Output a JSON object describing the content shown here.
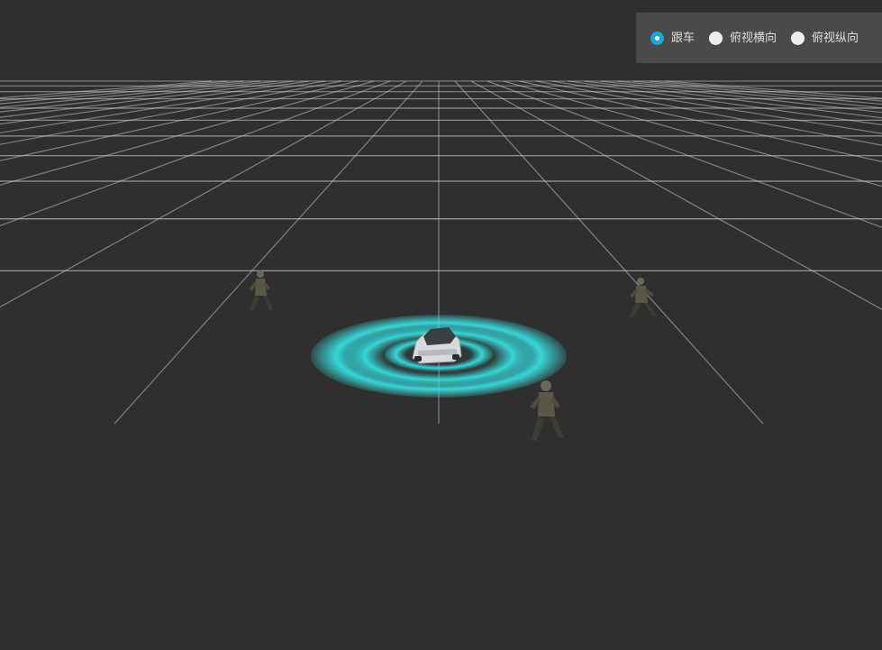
{
  "view_mode": {
    "selected": "follow",
    "options": [
      {
        "id": "follow",
        "label": "跟车",
        "checked": true
      },
      {
        "id": "top-horizontal",
        "label": "俯视横向",
        "checked": false
      },
      {
        "id": "top-vertical",
        "label": "俯视纵向",
        "checked": false
      }
    ]
  },
  "colors": {
    "background": "#2f2f2f",
    "grid": "#cfcfcf",
    "radar_ring": "#2fd8d8",
    "accent": "#1ba7d4",
    "panel": "#4a4a4a"
  },
  "scene": {
    "vehicle_icon": "car-icon",
    "pedestrian_icon": "soldier-icon",
    "pedestrian_count": 3,
    "radar_ring_count": 3
  }
}
